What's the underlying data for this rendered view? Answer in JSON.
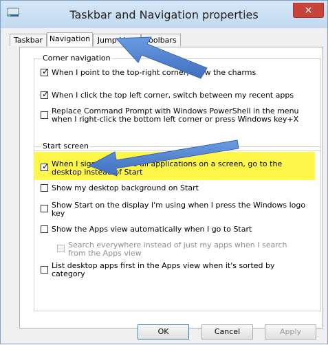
{
  "window": {
    "title": "Taskbar and Navigation properties",
    "close_glyph": "×"
  },
  "tabs": [
    {
      "label": "Taskbar",
      "active": false
    },
    {
      "label": "Navigation",
      "active": true
    },
    {
      "label": "Jump Lists",
      "active": false
    },
    {
      "label": "Toolbars",
      "active": false
    }
  ],
  "corner_navigation": {
    "legend": "Corner navigation",
    "options": [
      {
        "label": "When I point to the top-right corner, show the charms",
        "checked": true
      },
      {
        "label": "When I click the top left corner, switch between my recent apps",
        "checked": true
      },
      {
        "label": "Replace Command Prompt with Windows PowerShell in the menu when I right-click the bottom left corner or press Windows key+X",
        "checked": false
      }
    ]
  },
  "start_screen": {
    "legend": "Start screen",
    "options": [
      {
        "label": "When I sign in or close all applications on a screen, go to the desktop instead of Start",
        "checked": true,
        "highlighted": true
      },
      {
        "label": "Show my desktop background on Start",
        "checked": false
      },
      {
        "label": "Show Start on the display I'm using when I press the Windows logo key",
        "checked": false
      },
      {
        "label": "Show the Apps view automatically when I go to Start",
        "checked": false
      },
      {
        "label": "Search everywhere instead of just my apps when I search from the Apps view",
        "checked": false,
        "disabled": true
      },
      {
        "label": "List desktop apps first in the Apps view when it's sorted by category",
        "checked": false
      }
    ]
  },
  "buttons": {
    "ok": "OK",
    "cancel": "Cancel",
    "apply": "Apply"
  },
  "colors": {
    "highlight": "#fff64a",
    "arrow": "#4a7fd0",
    "close": "#c7443a"
  }
}
